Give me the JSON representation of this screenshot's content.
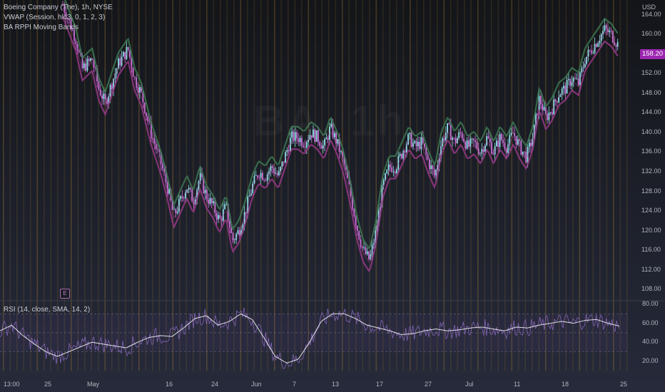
{
  "legend": {
    "symbol_line": "Boeing Company (The), 1h, NYSE",
    "vwap_line": "VWAP (Session, hlc3, 0, 1, 2, 3)",
    "bands_line": "BA RPPI Moving Bands",
    "rsi_line": "RSI (14, close, SMA, 14, 2)"
  },
  "watermark": "BA, 1h",
  "earnings_marker": "E",
  "price_axis": {
    "currency": "USD",
    "ticks": [
      "164.00",
      "160.00",
      "156.00",
      "152.00",
      "148.00",
      "144.00",
      "140.00",
      "136.00",
      "132.00",
      "128.00",
      "124.00",
      "120.00",
      "116.00",
      "112.00",
      "108.00"
    ],
    "current_price": "158.20"
  },
  "rsi_axis": {
    "ticks": [
      "80.00",
      "60.00",
      "40.00",
      "20.00"
    ]
  },
  "time_axis": {
    "ticks": [
      "13:00",
      "25",
      "May",
      "16",
      "24",
      "Jun",
      "7",
      "13",
      "17",
      "27",
      "Jul",
      "11",
      "18",
      "25"
    ]
  },
  "colors": {
    "background": "#151821",
    "candle_up": "#8fe0e8",
    "candle_down": "#c874d8",
    "band_upper": "#3f7d55",
    "band_lower": "#9c3a8c",
    "vwap": "#c73bb8",
    "rsi_line": "#8c6bc2",
    "rsi_ma": "#ffffff",
    "price_label": "#9c27b0",
    "session_stripe": "#c89632"
  },
  "chart_data": {
    "type": "candlestick",
    "ylim": [
      106,
      167
    ],
    "price_keypoints": [
      [
        0,
        166
      ],
      [
        4,
        159
      ],
      [
        6,
        153
      ],
      [
        9,
        155
      ],
      [
        11,
        149
      ],
      [
        13,
        146
      ],
      [
        17,
        154
      ],
      [
        20,
        157
      ],
      [
        22,
        151
      ],
      [
        24,
        148
      ],
      [
        27,
        140
      ],
      [
        30,
        134
      ],
      [
        32,
        129
      ],
      [
        34,
        123
      ],
      [
        36,
        126
      ],
      [
        38,
        129
      ],
      [
        40,
        126
      ],
      [
        42,
        131
      ],
      [
        44,
        127
      ],
      [
        46,
        125
      ],
      [
        48,
        122
      ],
      [
        50,
        125
      ],
      [
        52,
        118
      ],
      [
        54,
        120
      ],
      [
        56,
        124
      ],
      [
        58,
        129
      ],
      [
        60,
        132
      ],
      [
        62,
        131
      ],
      [
        64,
        133
      ],
      [
        66,
        131
      ],
      [
        68,
        135
      ],
      [
        70,
        139
      ],
      [
        72,
        139
      ],
      [
        74,
        138
      ],
      [
        76,
        140
      ],
      [
        78,
        139
      ],
      [
        80,
        137
      ],
      [
        82,
        141
      ],
      [
        84,
        138
      ],
      [
        86,
        134
      ],
      [
        88,
        128
      ],
      [
        90,
        121
      ],
      [
        92,
        116
      ],
      [
        94,
        114
      ],
      [
        96,
        120
      ],
      [
        98,
        129
      ],
      [
        100,
        133
      ],
      [
        102,
        133
      ],
      [
        104,
        136
      ],
      [
        106,
        139
      ],
      [
        108,
        137
      ],
      [
        110,
        138
      ],
      [
        112,
        134
      ],
      [
        114,
        131
      ],
      [
        116,
        138
      ],
      [
        118,
        141
      ],
      [
        120,
        138
      ],
      [
        122,
        140
      ],
      [
        124,
        137
      ],
      [
        126,
        138
      ],
      [
        128,
        136
      ],
      [
        130,
        139
      ],
      [
        132,
        136
      ],
      [
        134,
        139
      ],
      [
        136,
        137
      ],
      [
        138,
        140
      ],
      [
        140,
        137
      ],
      [
        142,
        135
      ],
      [
        144,
        139
      ],
      [
        146,
        147
      ],
      [
        148,
        143
      ],
      [
        150,
        145
      ],
      [
        152,
        148
      ],
      [
        154,
        149
      ],
      [
        156,
        151
      ],
      [
        158,
        150
      ],
      [
        160,
        155
      ],
      [
        162,
        157
      ],
      [
        164,
        159
      ],
      [
        166,
        161
      ],
      [
        168,
        160
      ],
      [
        170,
        158
      ]
    ],
    "rsi": {
      "ylim": [
        10,
        83
      ],
      "levels": [
        70,
        50,
        30
      ],
      "ma_keypoints": [
        [
          0,
          52
        ],
        [
          4,
          58
        ],
        [
          8,
          47
        ],
        [
          12,
          38
        ],
        [
          16,
          30
        ],
        [
          20,
          25
        ],
        [
          24,
          30
        ],
        [
          28,
          35
        ],
        [
          32,
          40
        ],
        [
          36,
          38
        ],
        [
          40,
          36
        ],
        [
          44,
          34
        ],
        [
          48,
          40
        ],
        [
          52,
          45
        ],
        [
          56,
          47
        ],
        [
          60,
          46
        ],
        [
          64,
          55
        ],
        [
          68,
          65
        ],
        [
          72,
          68
        ],
        [
          76,
          58
        ],
        [
          80,
          62
        ],
        [
          84,
          70
        ],
        [
          88,
          64
        ],
        [
          92,
          45
        ],
        [
          96,
          25
        ],
        [
          100,
          18
        ],
        [
          104,
          22
        ],
        [
          108,
          40
        ],
        [
          112,
          62
        ],
        [
          116,
          70
        ],
        [
          120,
          70
        ],
        [
          124,
          65
        ],
        [
          128,
          58
        ],
        [
          132,
          55
        ],
        [
          136,
          52
        ],
        [
          140,
          48
        ],
        [
          144,
          49
        ],
        [
          148,
          52
        ],
        [
          152,
          54
        ],
        [
          156,
          52
        ],
        [
          160,
          53
        ],
        [
          164,
          55
        ],
        [
          168,
          56
        ],
        [
          172,
          54
        ],
        [
          176,
          52
        ],
        [
          180,
          56
        ],
        [
          184,
          55
        ],
        [
          188,
          58
        ],
        [
          192,
          60
        ],
        [
          196,
          62
        ],
        [
          200,
          60
        ],
        [
          204,
          63
        ],
        [
          208,
          64
        ],
        [
          212,
          60
        ],
        [
          216,
          57
        ]
      ]
    }
  }
}
